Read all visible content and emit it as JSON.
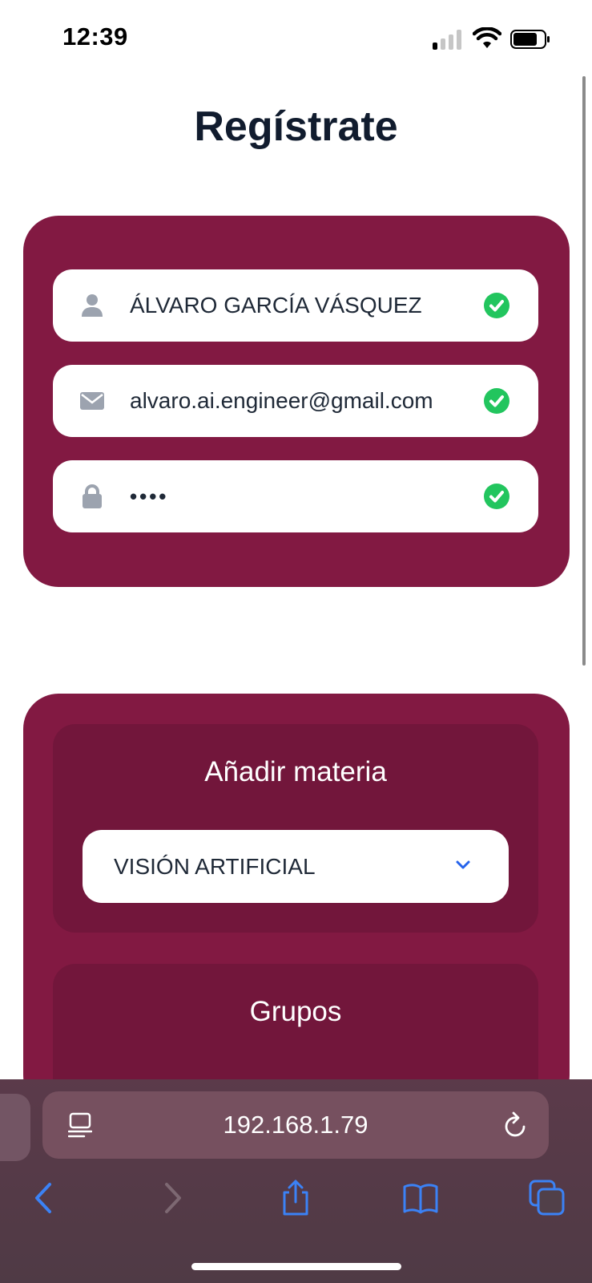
{
  "status_bar": {
    "time": "12:39"
  },
  "page": {
    "title": "Regístrate"
  },
  "registration": {
    "name": {
      "value": "ÁLVARO GARCÍA VÁSQUEZ",
      "icon": "user-icon"
    },
    "email": {
      "value": "alvaro.ai.engineer@gmail.com",
      "icon": "envelope-icon"
    },
    "password": {
      "value": "••••",
      "icon": "lock-icon"
    },
    "valid_icon": "check-circle-icon",
    "valid_color": "#22c55e"
  },
  "subjects": {
    "title": "Añadir materia",
    "selected": "VISIÓN ARTIFICIAL",
    "chevron_color": "#2563eb"
  },
  "groups": {
    "title": "Grupos"
  },
  "browser": {
    "url": "192.168.1.79",
    "accent": "#3b82f6"
  },
  "colors": {
    "card": "#821942",
    "panel": "#72163b",
    "title": "#111c2e"
  }
}
